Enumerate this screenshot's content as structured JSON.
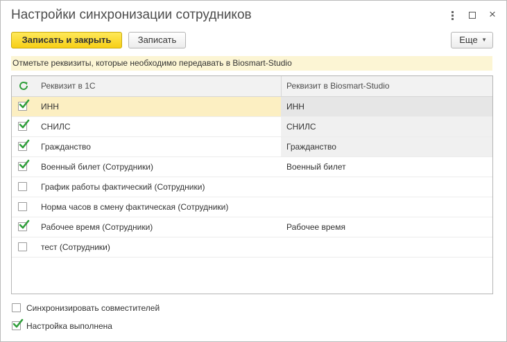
{
  "window": {
    "title": "Настройки синхронизации сотрудников",
    "controls": [
      "more-actions-icon",
      "maximize-icon",
      "close-icon"
    ]
  },
  "toolbar": {
    "save_close_label": "Записать и закрыть",
    "save_label": "Записать",
    "more_label": "Еще"
  },
  "hint": "Отметьте реквизиты, которые необходимо передавать в Biosmart-Studio",
  "table": {
    "columns": [
      "Реквизит в 1С",
      "Реквизит в Biosmart-Studio"
    ],
    "rows": [
      {
        "checked": true,
        "attr_1c": "ИНН",
        "attr_biosmart": "ИНН",
        "selected": true
      },
      {
        "checked": true,
        "attr_1c": "СНИЛС",
        "attr_biosmart": "СНИЛС",
        "selected": false
      },
      {
        "checked": true,
        "attr_1c": "Гражданство",
        "attr_biosmart": "Гражданство",
        "selected": false
      },
      {
        "checked": true,
        "attr_1c": "Военный билет (Сотрудники)",
        "attr_biosmart": "Военный билет",
        "selected": false
      },
      {
        "checked": false,
        "attr_1c": "График работы фактический (Сотрудники)",
        "attr_biosmart": "",
        "selected": false
      },
      {
        "checked": false,
        "attr_1c": "Норма часов в смену фактическая (Сотрудники)",
        "attr_biosmart": "",
        "selected": false
      },
      {
        "checked": true,
        "attr_1c": "Рабочее время (Сотрудники)",
        "attr_biosmart": "Рабочее время",
        "selected": false
      },
      {
        "checked": false,
        "attr_1c": "тест (Сотрудники)",
        "attr_biosmart": "",
        "selected": false
      }
    ]
  },
  "options": {
    "sync_part_time": {
      "label": "Синхронизировать совместителей",
      "checked": false
    },
    "setup_done": {
      "label": "Настройка выполнена",
      "checked": true
    }
  },
  "colors": {
    "primary_button": "#f7d31e",
    "hint_background": "#fcf5d4",
    "selected_row": "#fcefc2",
    "check_green": "#2f9e3a"
  }
}
